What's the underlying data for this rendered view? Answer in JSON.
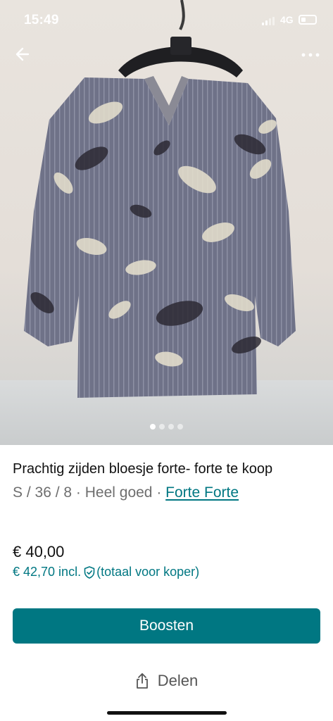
{
  "status_bar": {
    "time": "15:49",
    "network": "4G"
  },
  "gallery": {
    "image_count": 4,
    "active_index": 0
  },
  "toolbar": {
    "back_icon": "arrow-left-icon",
    "more_icon": "more-horizontal-icon"
  },
  "item": {
    "title": "Prachtig zijden bloesje forte- forte te koop",
    "size": "S / 36 / 8",
    "separator": " · ",
    "condition": "Heel goed",
    "brand": "Forte Forte",
    "price": "€ 40,00",
    "price_incl": "€ 42,70 incl.",
    "price_incl_note": "(totaal voor koper)"
  },
  "actions": {
    "boost_label": "Boosten",
    "share_label": "Delen"
  },
  "colors": {
    "accent": "#007782",
    "text": "#111111",
    "muted": "#6e6e6e"
  }
}
